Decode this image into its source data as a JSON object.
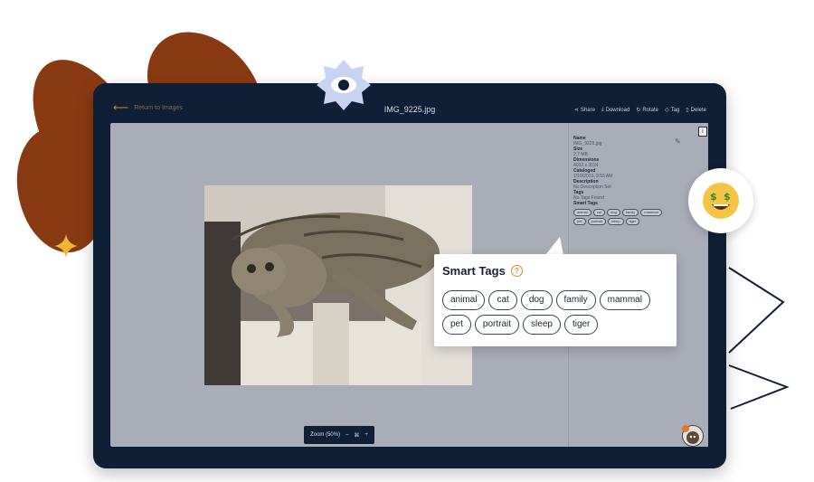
{
  "topbar": {
    "back_label": "Return to Images",
    "title": "IMG_9225.jpg",
    "actions": [
      {
        "icon": "share-icon",
        "label": "Share"
      },
      {
        "icon": "download-icon",
        "label": "Download"
      },
      {
        "icon": "rotate-icon",
        "label": "Rotate"
      },
      {
        "icon": "tag-icon",
        "label": "Tag"
      },
      {
        "icon": "trash-icon",
        "label": "Delete"
      }
    ]
  },
  "zoom": {
    "label": "Zoom (50%)",
    "minus": "–",
    "fit": "⌘",
    "plus": "+"
  },
  "details": {
    "name_label": "Name",
    "name_value": "IMG_9225.jpg",
    "size_label": "Size",
    "size_value": "2.7 MB",
    "dimensions_label": "Dimensions",
    "dimensions_value": "4032 x 3024",
    "cataloged_label": "Cataloged",
    "cataloged_value": "1/19/2023, 9:53 AM",
    "description_label": "Description",
    "description_value": "No Description Set",
    "tags_label": "Tags",
    "tags_value": "No Tags Found",
    "smart_tags_label": "Smart Tags"
  },
  "smart_tags": {
    "title": "Smart Tags",
    "help": "?",
    "items": [
      "animal",
      "cat",
      "dog",
      "family",
      "mammal",
      "pet",
      "portrait",
      "sleep",
      "tiger"
    ]
  },
  "colors": {
    "frame": "#0f1f36",
    "viewer_bg": "#a8adb8",
    "petal": "#8a3a12",
    "accent": "#d18a2e",
    "eye_badge": "#c9d4f5"
  }
}
